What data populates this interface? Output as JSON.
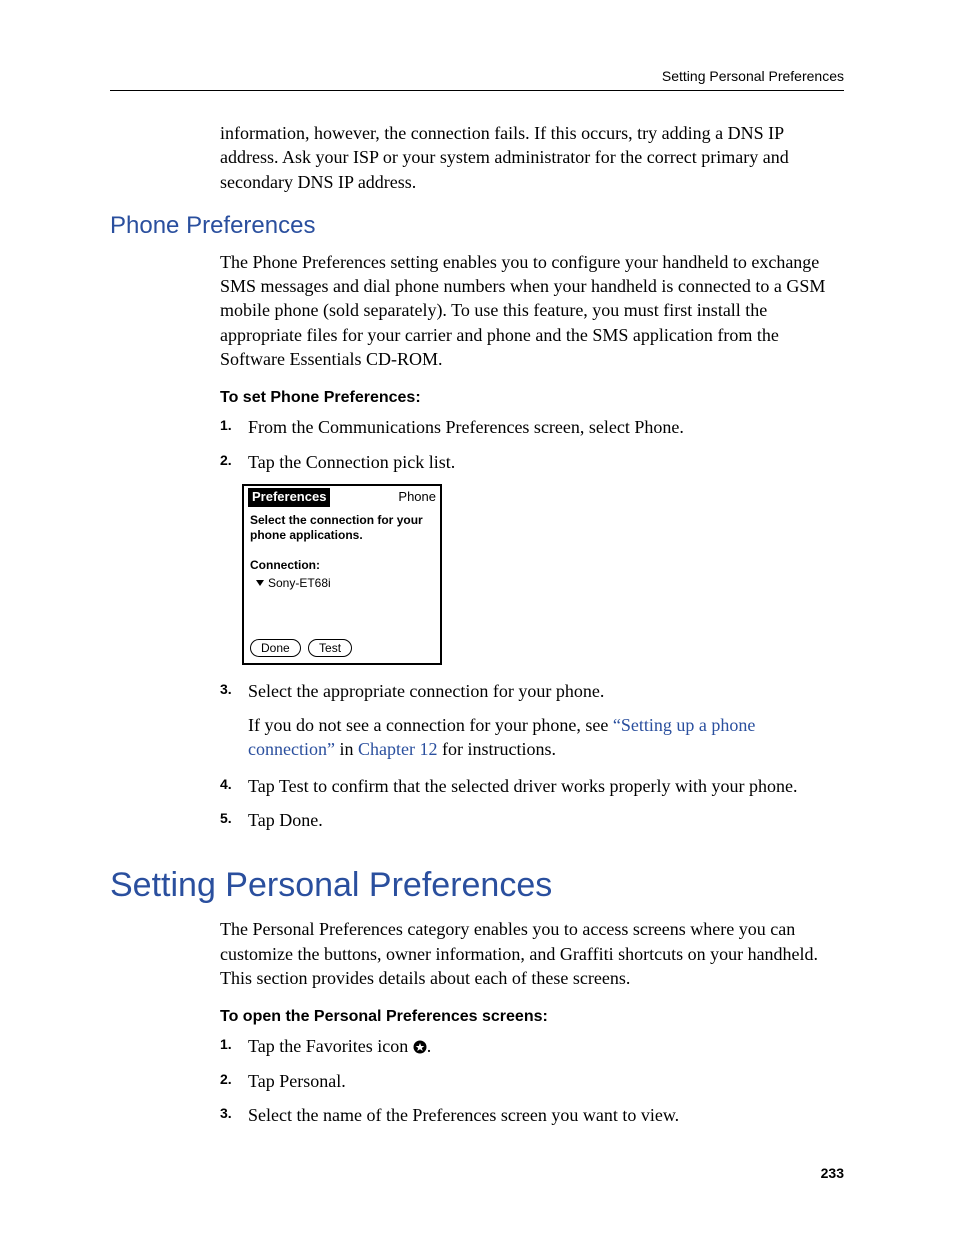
{
  "header": {
    "running_head": "Setting Personal Preferences"
  },
  "intro_para": "information, however, the connection fails. If this occurs, try adding a DNS IP address. Ask your ISP or your system administrator for the correct primary and secondary DNS IP address.",
  "phone_prefs": {
    "heading": "Phone Preferences",
    "para": "The Phone Preferences setting enables you to configure your handheld to exchange SMS messages and dial phone numbers when your handheld is connected to a GSM mobile phone (sold separately). To use this feature, you must first install the appropriate files for your carrier and phone and the SMS application from the Software Essentials CD-ROM.",
    "subhead": "To set Phone Preferences:",
    "step1": "From the Communications Preferences screen, select Phone.",
    "step2": "Tap the Connection pick list.",
    "step3": "Select the appropriate connection for your phone.",
    "step3_sub_prefix": "If you do not see a connection for your phone, see ",
    "step3_link1": "“Setting up a phone connection”",
    "step3_sub_mid": " in ",
    "step3_link2": "Chapter 12",
    "step3_sub_suffix": " for instructions.",
    "step4": "Tap Test to confirm that the selected driver works properly with your phone.",
    "step5": "Tap Done."
  },
  "mock": {
    "title_left": "Preferences",
    "title_right": "Phone",
    "prompt": "Select the connection for your phone applications.",
    "conn_label": "Connection:",
    "conn_value": "Sony-ET68i",
    "btn_done": "Done",
    "btn_test": "Test"
  },
  "personal_prefs": {
    "heading": "Setting Personal Preferences",
    "para": "The Personal Preferences category enables you to access screens where you can customize the buttons, owner information, and Graffiti shortcuts on your handheld. This section provides details about each of these screens.",
    "subhead": "To open the Personal Preferences screens:",
    "step1_prefix": "Tap the Favorites icon ",
    "step1_suffix": ".",
    "step2": "Tap Personal.",
    "step3": "Select the name of the Preferences screen you want to view."
  },
  "page_number": "233"
}
